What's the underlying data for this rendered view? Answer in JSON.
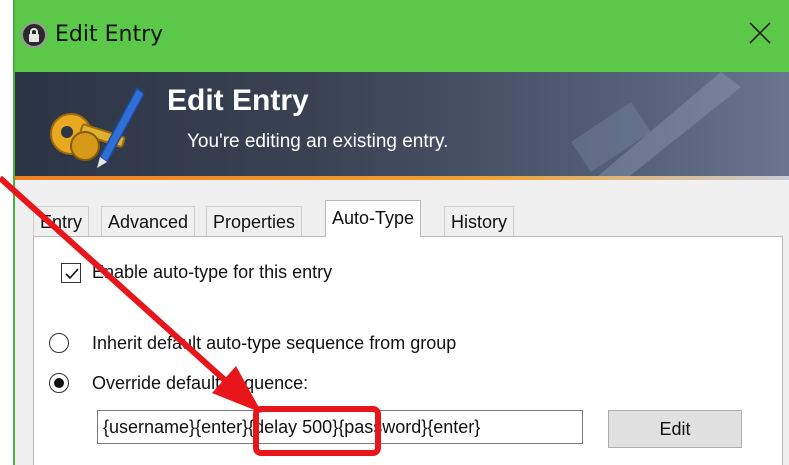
{
  "window": {
    "title": "Edit Entry",
    "close_symbol": "✕"
  },
  "banner": {
    "title": "Edit Entry",
    "subtitle": "You're editing an existing entry."
  },
  "tabs": [
    {
      "label": "Entry",
      "active": false
    },
    {
      "label": "Advanced",
      "active": false
    },
    {
      "label": "Properties",
      "active": false
    },
    {
      "label": "Auto-Type",
      "active": true
    },
    {
      "label": "History",
      "active": false
    }
  ],
  "autotype": {
    "enable_label": "Enable auto-type for this entry",
    "enable_checked": true,
    "inherit_label": "Inherit default auto-type sequence from group",
    "inherit_selected": false,
    "override_label": "Override default sequence:",
    "override_selected": true,
    "sequence_value": "{username}{enter}{delay 500}{password}{enter}",
    "edit_button": "Edit"
  },
  "annotation": {
    "highlight_color": "#e8161b"
  },
  "colors": {
    "titlebar": "#5cc84a",
    "accent_stripe": "#f08020"
  },
  "icons": [
    "keepass-lock-icon",
    "close-icon",
    "keys-pen-icon",
    "check-icon"
  ]
}
